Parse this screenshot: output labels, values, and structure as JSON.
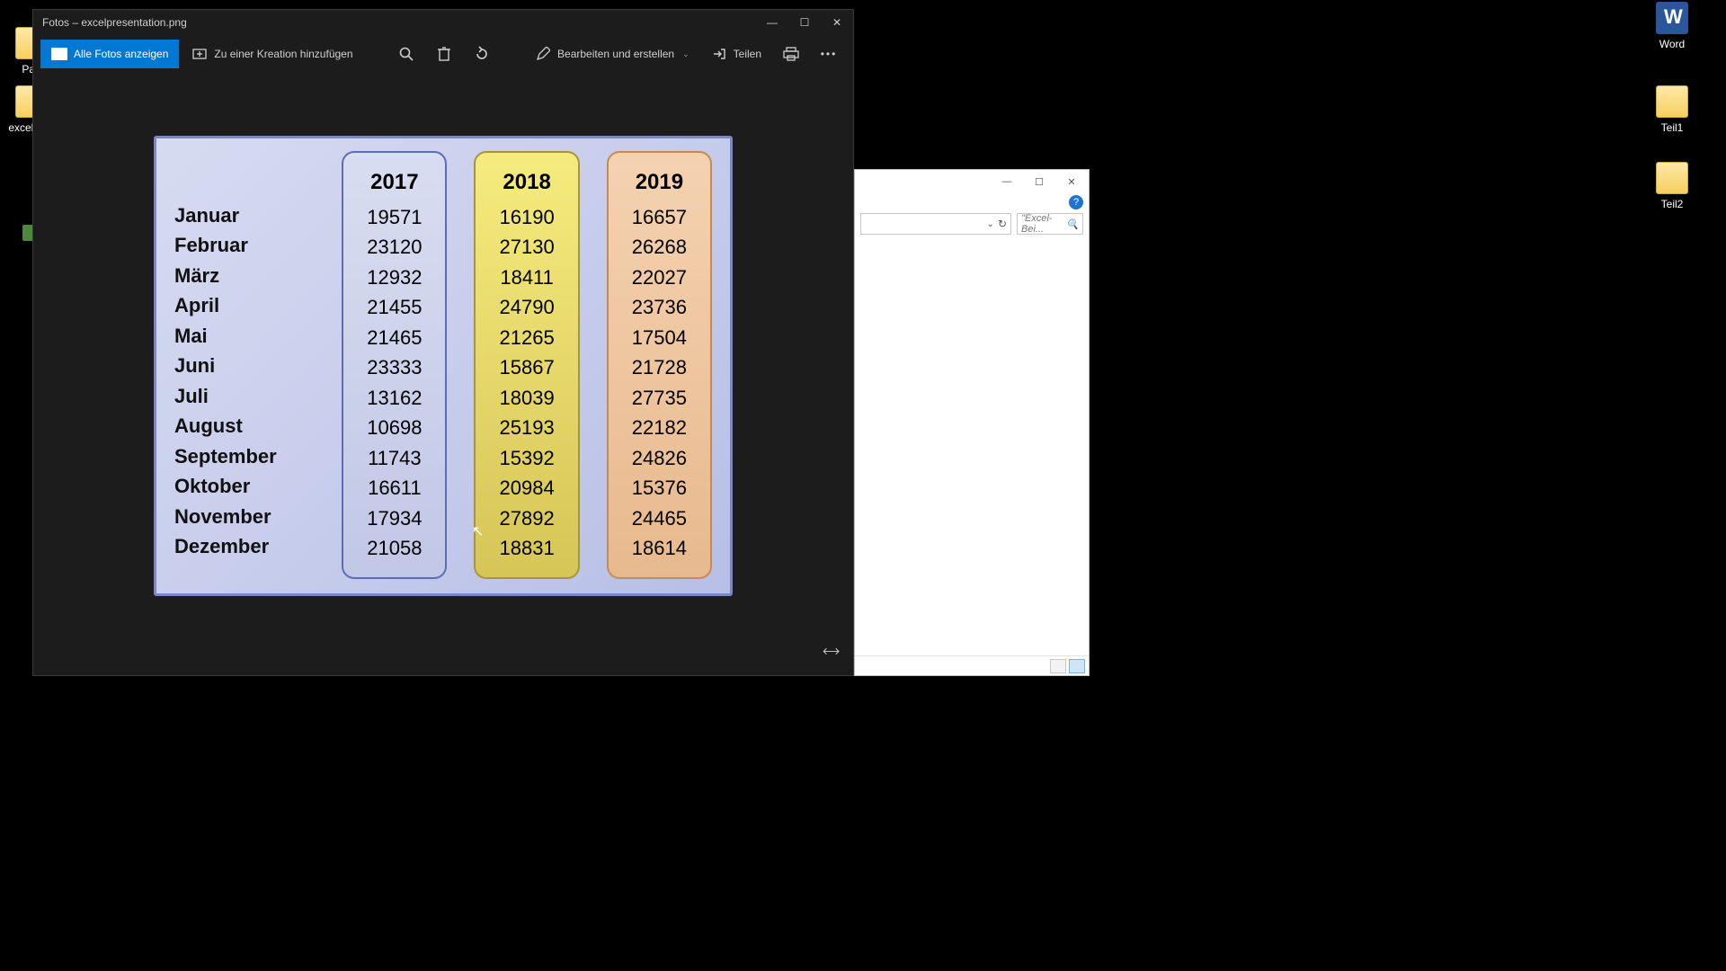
{
  "desktop": {
    "word_label": "Word",
    "teil1_label": "Teil1",
    "teil2_label": "Teil2",
    "pap_label": "Pap",
    "excelpres_label": "excelpres"
  },
  "photos": {
    "title": "Fotos – excelpresentation.png",
    "btn_all_photos": "Alle Fotos anzeigen",
    "btn_add_creation": "Zu einer Kreation hinzufügen",
    "btn_edit_create": "Bearbeiten und erstellen",
    "btn_share": "Teilen"
  },
  "explorer": {
    "search_placeholder": "\"Excel-Bei..."
  },
  "chart_data": {
    "type": "table",
    "title": "",
    "columns": [
      "2017",
      "2018",
      "2019"
    ],
    "rows": [
      "Januar",
      "Februar",
      "März",
      "April",
      "Mai",
      "Juni",
      "Juli",
      "August",
      "September",
      "Oktober",
      "November",
      "Dezember"
    ],
    "series": [
      {
        "name": "2017",
        "values": [
          19571,
          23120,
          12932,
          21455,
          21465,
          23333,
          13162,
          10698,
          11743,
          16611,
          17934,
          21058
        ]
      },
      {
        "name": "2018",
        "values": [
          16190,
          27130,
          18411,
          24790,
          21265,
          15867,
          18039,
          25193,
          15392,
          20984,
          27892,
          18831
        ]
      },
      {
        "name": "2019",
        "values": [
          16657,
          26268,
          22027,
          23736,
          17504,
          21728,
          27735,
          22182,
          24826,
          15376,
          24465,
          18614
        ]
      }
    ]
  }
}
